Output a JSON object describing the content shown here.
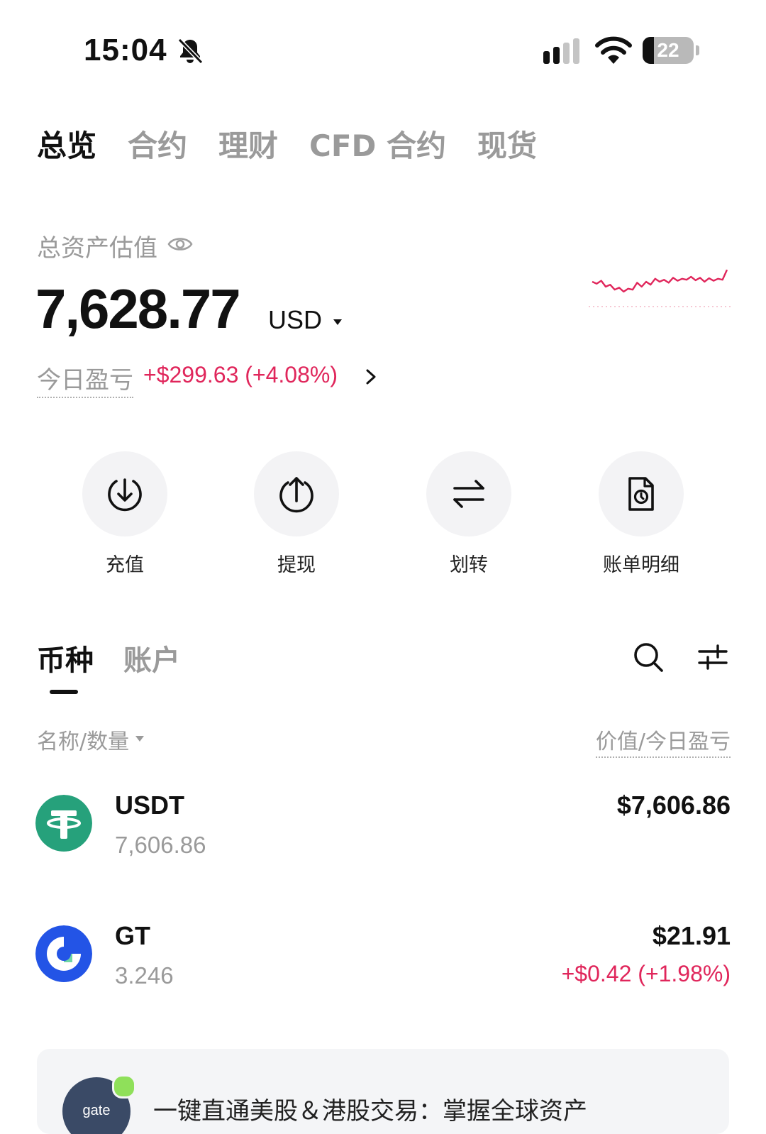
{
  "status_bar": {
    "time": "15:04",
    "battery": "22",
    "battery_level": 0.22,
    "icons": [
      "bell-slash-icon",
      "cellular-signal-icon",
      "wifi-icon",
      "battery-icon"
    ]
  },
  "top_tabs": [
    {
      "label": "总览",
      "active": true
    },
    {
      "label": "合约",
      "active": false
    },
    {
      "label": "理财",
      "active": false
    },
    {
      "label": "CFD 合约",
      "active": false
    },
    {
      "label": "现货",
      "active": false
    }
  ],
  "balance": {
    "label": "总资产估值",
    "amount": "7,628.77",
    "currency": "USD",
    "pnl_label": "今日盈亏",
    "pnl_value": "+$299.63 (+4.08%)",
    "sparkline_color": "#e0265b",
    "sparkline": [
      0.3,
      0.34,
      0.28,
      0.4,
      0.36,
      0.46,
      0.42,
      0.5,
      0.44,
      0.46,
      0.32,
      0.4,
      0.3,
      0.36,
      0.24,
      0.3,
      0.26,
      0.32,
      0.22,
      0.28,
      0.24,
      0.26,
      0.2,
      0.27,
      0.22,
      0.3,
      0.23,
      0.28,
      0.24,
      0.26,
      0.06
    ]
  },
  "actions": [
    {
      "label": "充值",
      "icon": "deposit-arrow-down-icon"
    },
    {
      "label": "提现",
      "icon": "withdraw-arrow-up-icon"
    },
    {
      "label": "划转",
      "icon": "transfer-arrows-icon"
    },
    {
      "label": "账单明细",
      "icon": "bill-document-clock-icon"
    }
  ],
  "asset_tabs": [
    {
      "label": "币种",
      "active": true
    },
    {
      "label": "账户",
      "active": false
    }
  ],
  "list_header": {
    "left": "名称/数量",
    "right": "价值/今日盈亏"
  },
  "assets": [
    {
      "name": "USDT",
      "qty": "7,606.86",
      "value": "$7,606.86",
      "pnl": "",
      "logo_color": "#26a17b",
      "icon": "tether-icon"
    },
    {
      "name": "GT",
      "qty": "3.246",
      "value": "$21.91",
      "pnl": "+$0.42 (+1.98%)",
      "logo_color": "#2354e6",
      "icon": "gatetoken-icon"
    }
  ],
  "promo": {
    "text": "一键直通美股＆港股交易：掌握全球资产",
    "avatar_text": "gate"
  },
  "colors": {
    "accent_red": "#e0265b",
    "muted": "#9a9a9a"
  }
}
